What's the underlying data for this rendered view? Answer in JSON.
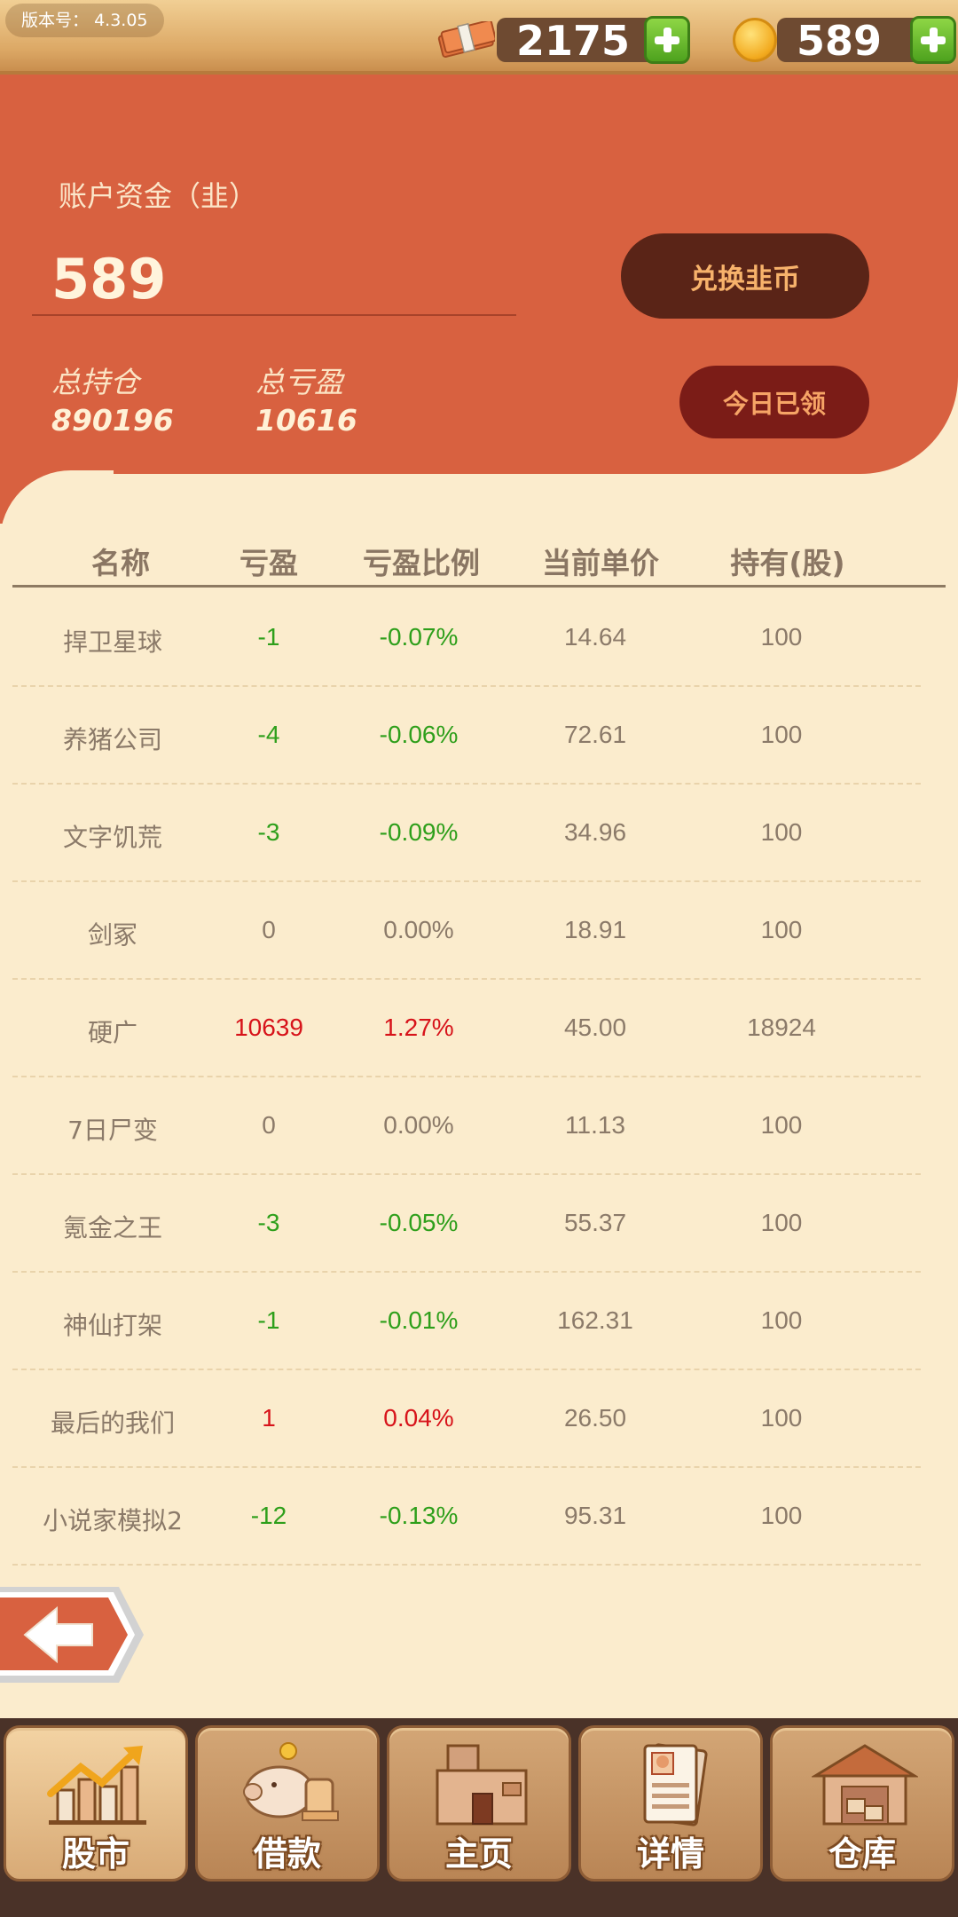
{
  "topbar": {
    "version_label": "版本号：",
    "version_value": "4.3.05",
    "cash_amount": "2175",
    "coin_amount": "589",
    "cash_icon": "cash-bundle-icon",
    "coin_icon": "gold-coin-icon",
    "add_icon": "plus-icon"
  },
  "account": {
    "label": "账户资金（韭）",
    "value": "589",
    "exchange_button": "兑换韭币",
    "claimed_button": "今日已领",
    "total_position_label": "总持仓",
    "total_position_value": "890196",
    "total_pnl_label": "总亏盈",
    "total_pnl_value": "10616"
  },
  "table": {
    "headers": [
      "名称",
      "亏盈",
      "亏盈比例",
      "当前单价",
      "持有(股)"
    ],
    "rows": [
      {
        "name": "捍卫星球",
        "pnl": "-1",
        "ratio": "-0.07%",
        "price": "14.64",
        "held": "100",
        "trend": "neg"
      },
      {
        "name": "养猪公司",
        "pnl": "-4",
        "ratio": "-0.06%",
        "price": "72.61",
        "held": "100",
        "trend": "neg"
      },
      {
        "name": "文字饥荒",
        "pnl": "-3",
        "ratio": "-0.09%",
        "price": "34.96",
        "held": "100",
        "trend": "neg"
      },
      {
        "name": "剑冢",
        "pnl": "0",
        "ratio": "0.00%",
        "price": "18.91",
        "held": "100",
        "trend": "zero"
      },
      {
        "name": "硬广",
        "pnl": "10639",
        "ratio": "1.27%",
        "price": "45.00",
        "held": "18924",
        "trend": "pos"
      },
      {
        "name": "7日尸变",
        "pnl": "0",
        "ratio": "0.00%",
        "price": "11.13",
        "held": "100",
        "trend": "zero"
      },
      {
        "name": "氪金之王",
        "pnl": "-3",
        "ratio": "-0.05%",
        "price": "55.37",
        "held": "100",
        "trend": "neg"
      },
      {
        "name": "神仙打架",
        "pnl": "-1",
        "ratio": "-0.01%",
        "price": "162.31",
        "held": "100",
        "trend": "neg"
      },
      {
        "name": "最后的我们",
        "pnl": "1",
        "ratio": "0.04%",
        "price": "26.50",
        "held": "100",
        "trend": "pos"
      },
      {
        "name": "小说家模拟2",
        "pnl": "-12",
        "ratio": "-0.13%",
        "price": "95.31",
        "held": "100",
        "trend": "neg"
      }
    ]
  },
  "back_icon": "arrow-left-icon",
  "nav": {
    "tabs": [
      {
        "label": "股市",
        "icon": "stock-chart-icon",
        "active": true
      },
      {
        "label": "借款",
        "icon": "piggy-bank-icon",
        "active": false
      },
      {
        "label": "主页",
        "icon": "house-icon",
        "active": false
      },
      {
        "label": "详情",
        "icon": "profile-card-icon",
        "active": false
      },
      {
        "label": "仓库",
        "icon": "warehouse-icon",
        "active": false
      }
    ]
  },
  "colors": {
    "panel": "#d86140",
    "background": "#fbeccd",
    "loss_green": "#2e9f1b",
    "gain_red": "#d7131a",
    "exchange_button": "#5a2417",
    "claimed_button": "#7b1c17"
  }
}
